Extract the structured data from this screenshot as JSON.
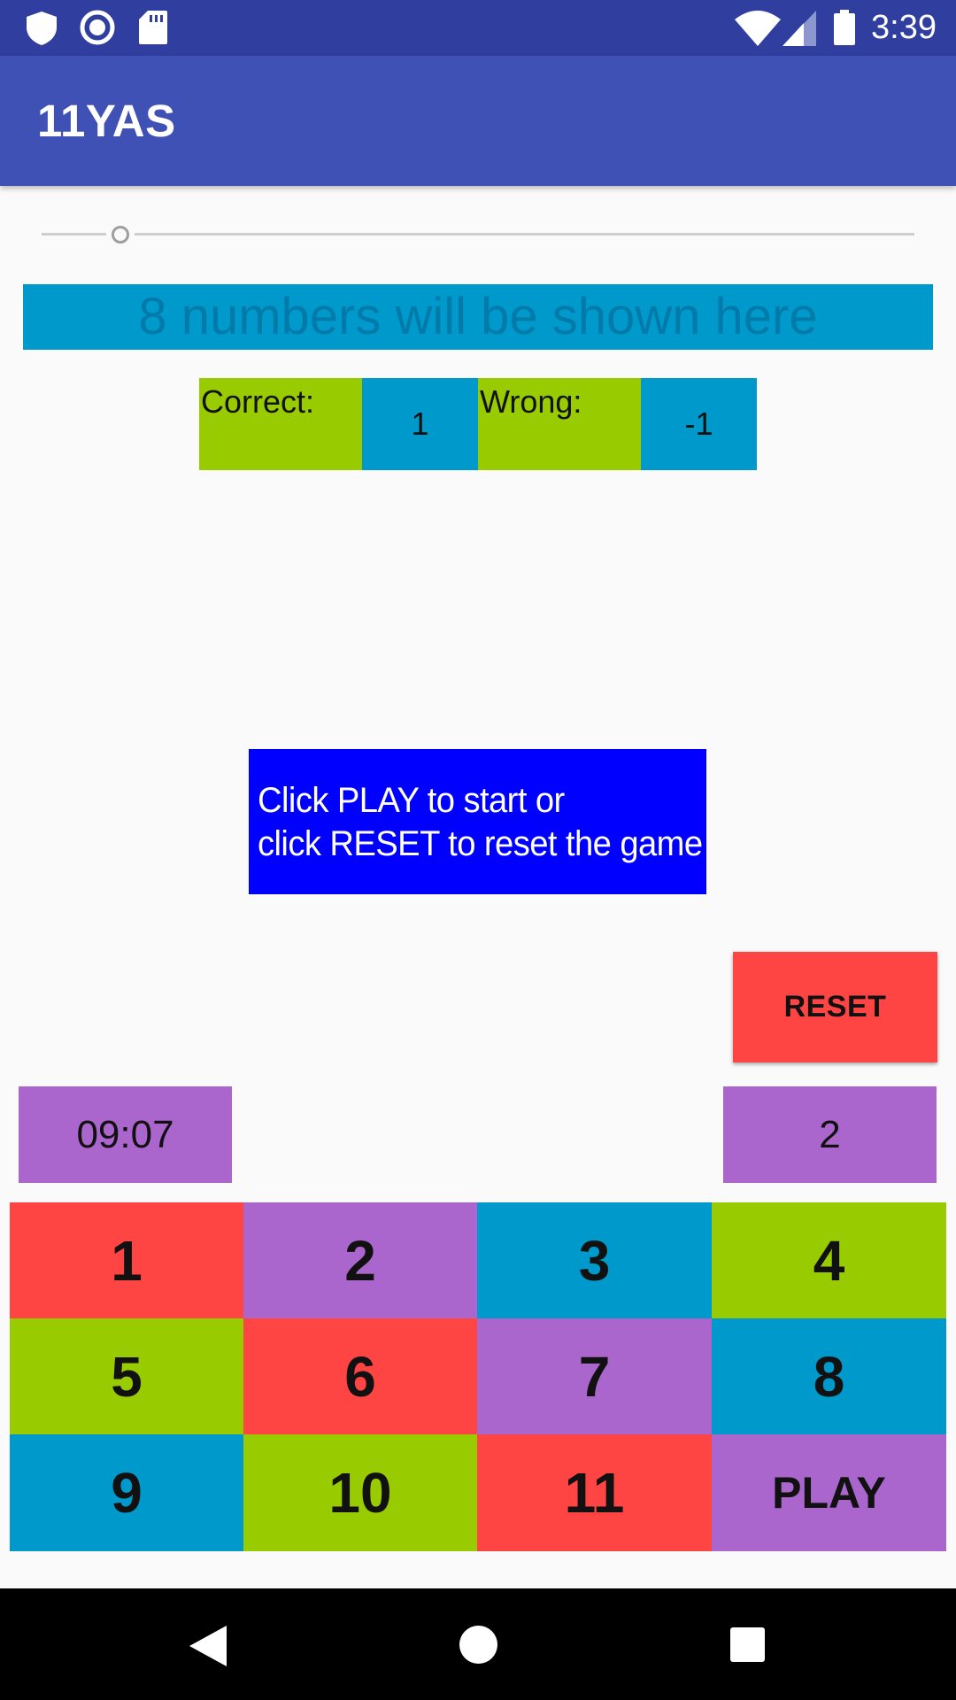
{
  "status_bar": {
    "time": "3:39",
    "left_icons": [
      "shield-icon",
      "circle-record-icon",
      "sd-card-icon"
    ],
    "right_icons": [
      "wifi-icon",
      "signal-icon",
      "battery-icon"
    ],
    "background": "#303f9f"
  },
  "app_bar": {
    "title": "11YAS",
    "background": "#3f51b5"
  },
  "slider": {
    "value_fraction": 0.09
  },
  "numbers_display": {
    "text": "8 numbers will be shown here",
    "background": "#0099cc"
  },
  "score": {
    "correct_label": "Correct:",
    "correct_value": "1",
    "wrong_label": "Wrong:",
    "wrong_value": "-1"
  },
  "info": {
    "line1": "Click PLAY to start or",
    "line2": "click RESET to reset the game",
    "background": "#0000ff"
  },
  "reset_button": {
    "label": "RESET",
    "background": "#ff4444"
  },
  "timer": {
    "value": "09:07"
  },
  "count": {
    "value": "2"
  },
  "keypad": {
    "keys": [
      {
        "label": "1",
        "color": "red"
      },
      {
        "label": "2",
        "color": "purple"
      },
      {
        "label": "3",
        "color": "blue"
      },
      {
        "label": "4",
        "color": "green"
      },
      {
        "label": "5",
        "color": "green"
      },
      {
        "label": "6",
        "color": "red"
      },
      {
        "label": "7",
        "color": "purple"
      },
      {
        "label": "8",
        "color": "blue"
      },
      {
        "label": "9",
        "color": "blue"
      },
      {
        "label": "10",
        "color": "green"
      },
      {
        "label": "11",
        "color": "red"
      },
      {
        "label": "PLAY",
        "color": "purple"
      }
    ],
    "colors": {
      "red": "#ff4444",
      "purple": "#aa66cc",
      "blue": "#0099cc",
      "green": "#99cc00"
    }
  },
  "nav_bar": {
    "icons": [
      "back-icon",
      "home-icon",
      "recents-icon"
    ]
  }
}
